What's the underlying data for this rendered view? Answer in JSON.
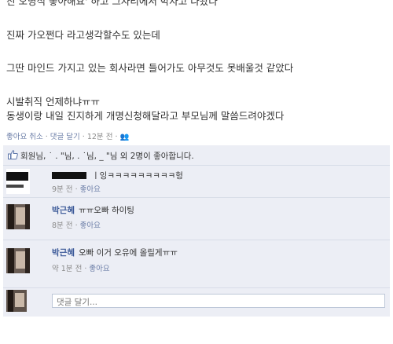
{
  "post": {
    "lines": [
      "진 오명식 좋아해요' 하고 그자리에서 박자고 나왔다",
      "진짜 가오쩐다 라고생각할수도 있는데",
      "그딴 마인드 가지고 있는 회사라면 들어가도 아무것도 못배울것 같았다",
      "시발취직 언제하냐ㅠㅠ",
      "동생이랑 내일 진지하게 개명신청해달라고 부모님께 말씀드려야겠다"
    ],
    "actions": {
      "like": "좋아요 취소",
      "sep1": " · ",
      "comment": "댓글 달기",
      "sep2": " · ",
      "time": "12분 전",
      "sep3": " · ",
      "audience": "👥"
    }
  },
  "likes": {
    "text": "회원님, ˙ . \"님, . ˙님, _ \"님 외 2명이 좋아합니다."
  },
  "comments": [
    {
      "name": "",
      "text": "ㅣ잉ㅋㅋㅋㅋㅋㅋㅋㅋㅋ헝",
      "time": "9분 전",
      "sep": " · ",
      "like": "좋아요"
    },
    {
      "name": "박근혜",
      "text": "ㅠㅠ오빠 하이팅",
      "time": "8분 전",
      "sep": " · ",
      "like": "좋아요"
    },
    {
      "name": "박근혜",
      "text": "오빠 이거 오유에 올릴게ㅠㅠ",
      "time": "약 1분 전",
      "sep": " · ",
      "like": "좋아요"
    }
  ],
  "reply": {
    "placeholder": "댓글 달기..."
  },
  "colors": {
    "link": "#3b5998",
    "panel_bg": "#eceef5",
    "meta": "#8a8a8a"
  }
}
